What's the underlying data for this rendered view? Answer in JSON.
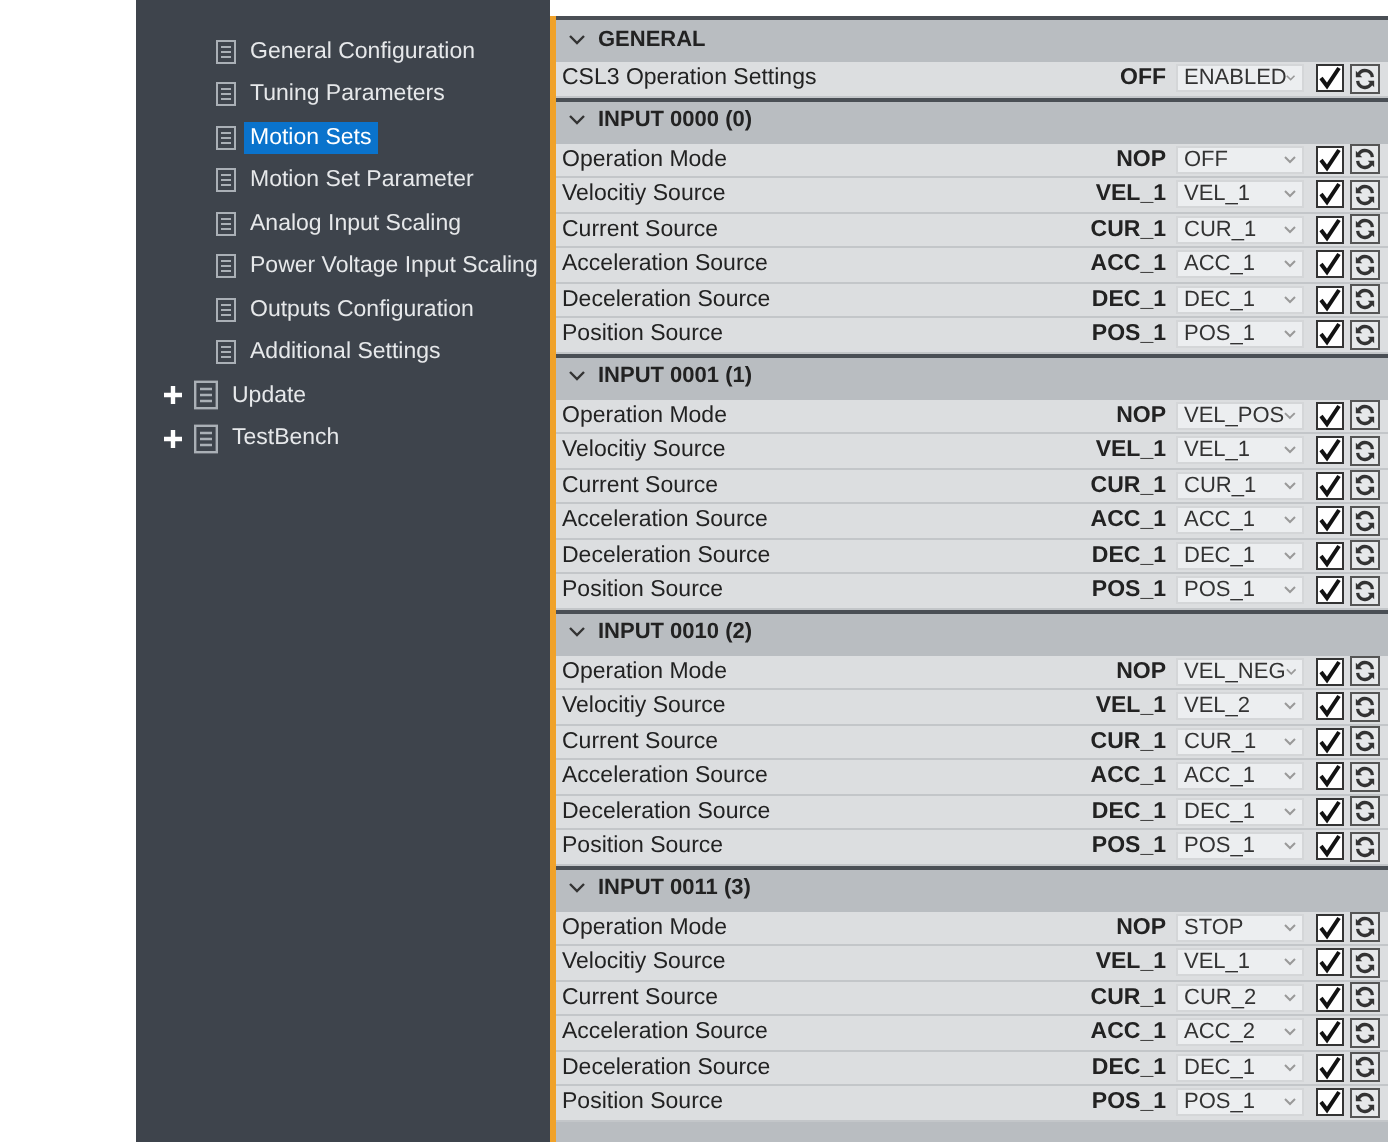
{
  "sidebar": {
    "items": [
      {
        "label": "General Configuration",
        "selected": false
      },
      {
        "label": "Tuning Parameters",
        "selected": false
      },
      {
        "label": "Motion Sets",
        "selected": true
      },
      {
        "label": "Motion Set Parameter",
        "selected": false
      },
      {
        "label": "Analog Input Scaling",
        "selected": false
      },
      {
        "label": "Power Voltage Input Scaling",
        "selected": false
      },
      {
        "label": "Outputs Configuration",
        "selected": false
      },
      {
        "label": "Additional Settings",
        "selected": false
      }
    ],
    "groups": [
      {
        "label": "Update",
        "expanded": false
      },
      {
        "label": "TestBench",
        "expanded": false
      }
    ]
  },
  "sections": [
    {
      "title": "GENERAL",
      "expanded": true,
      "rows": [
        {
          "label": "CSL3 Operation Settings",
          "value": "OFF",
          "option": "ENABLED",
          "checked": true
        }
      ]
    },
    {
      "title": "INPUT 0000 (0)",
      "expanded": true,
      "rows": [
        {
          "label": "Operation Mode",
          "value": "NOP",
          "option": "OFF",
          "checked": true
        },
        {
          "label": "Velocitiy Source",
          "value": "VEL_1",
          "option": "VEL_1",
          "checked": true
        },
        {
          "label": "Current Source",
          "value": "CUR_1",
          "option": "CUR_1",
          "checked": true
        },
        {
          "label": "Acceleration Source",
          "value": "ACC_1",
          "option": "ACC_1",
          "checked": true
        },
        {
          "label": "Deceleration Source",
          "value": "DEC_1",
          "option": "DEC_1",
          "checked": true
        },
        {
          "label": "Position Source",
          "value": "POS_1",
          "option": "POS_1",
          "checked": true
        }
      ]
    },
    {
      "title": "INPUT 0001 (1)",
      "expanded": true,
      "rows": [
        {
          "label": "Operation Mode",
          "value": "NOP",
          "option": "VEL_POS",
          "checked": true
        },
        {
          "label": "Velocitiy Source",
          "value": "VEL_1",
          "option": "VEL_1",
          "checked": true
        },
        {
          "label": "Current Source",
          "value": "CUR_1",
          "option": "CUR_1",
          "checked": true
        },
        {
          "label": "Acceleration Source",
          "value": "ACC_1",
          "option": "ACC_1",
          "checked": true
        },
        {
          "label": "Deceleration Source",
          "value": "DEC_1",
          "option": "DEC_1",
          "checked": true
        },
        {
          "label": "Position Source",
          "value": "POS_1",
          "option": "POS_1",
          "checked": true
        }
      ]
    },
    {
      "title": "INPUT 0010 (2)",
      "expanded": true,
      "rows": [
        {
          "label": "Operation Mode",
          "value": "NOP",
          "option": "VEL_NEG",
          "checked": true
        },
        {
          "label": "Velocitiy Source",
          "value": "VEL_1",
          "option": "VEL_2",
          "checked": true
        },
        {
          "label": "Current Source",
          "value": "CUR_1",
          "option": "CUR_1",
          "checked": true
        },
        {
          "label": "Acceleration Source",
          "value": "ACC_1",
          "option": "ACC_1",
          "checked": true
        },
        {
          "label": "Deceleration Source",
          "value": "DEC_1",
          "option": "DEC_1",
          "checked": true
        },
        {
          "label": "Position Source",
          "value": "POS_1",
          "option": "POS_1",
          "checked": true
        }
      ]
    },
    {
      "title": "INPUT 0011 (3)",
      "expanded": true,
      "rows": [
        {
          "label": "Operation Mode",
          "value": "NOP",
          "option": "STOP",
          "checked": true
        },
        {
          "label": "Velocitiy Source",
          "value": "VEL_1",
          "option": "VEL_1",
          "checked": true
        },
        {
          "label": "Current Source",
          "value": "CUR_1",
          "option": "CUR_2",
          "checked": true
        },
        {
          "label": "Acceleration Source",
          "value": "ACC_1",
          "option": "ACC_2",
          "checked": true
        },
        {
          "label": "Deceleration Source",
          "value": "DEC_1",
          "option": "DEC_1",
          "checked": true
        },
        {
          "label": "Position Source",
          "value": "POS_1",
          "option": "POS_1",
          "checked": true
        }
      ]
    }
  ]
}
